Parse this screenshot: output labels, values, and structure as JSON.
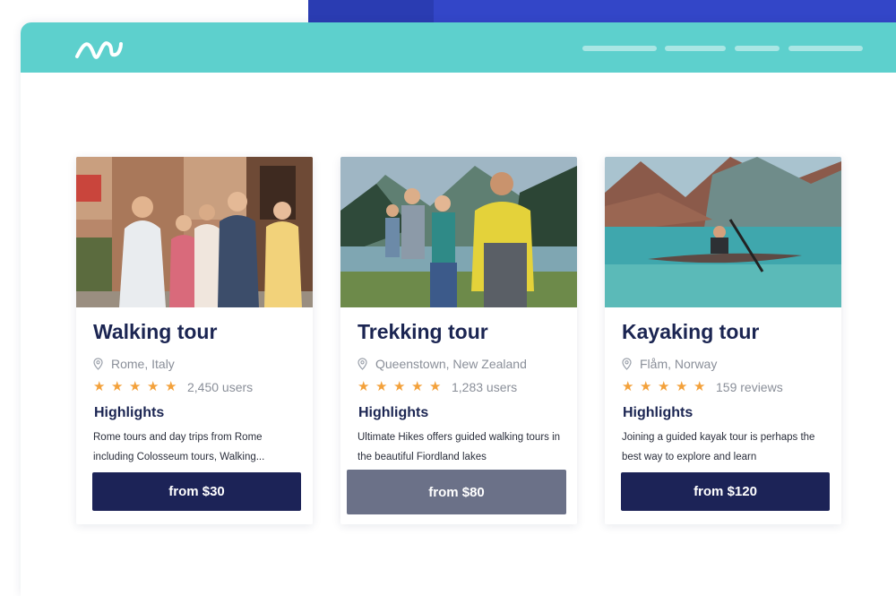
{
  "colors": {
    "topbar": "#5dd0cd",
    "accent_blue": "#3346c8",
    "title_navy": "#1b2552",
    "button_navy": "#1c2357",
    "button_hover": "#6b7188",
    "star": "#f3a13b",
    "muted_text": "#8a8f99"
  },
  "header": {
    "logo_icon": "wave-logo-icon",
    "nav_items": 4
  },
  "tours": [
    {
      "title": "Walking tour",
      "location": "Rome, Italy",
      "rating_stars": 5,
      "count": "2,450 users",
      "highlights_heading": "Highlights",
      "description": "Rome tours and day trips from Rome including Colosseum tours, Walking...",
      "price_button": "from $30"
    },
    {
      "title": "Trekking tour",
      "location": "Queenstown, New Zealand",
      "rating_stars": 5,
      "count": "1,283 users",
      "highlights_heading": "Highlights",
      "description": "Ultimate Hikes offers guided walking tours in the beautiful Fiordland lakes",
      "price_button": "from $80"
    },
    {
      "title": "Kayaking tour",
      "location": "Flåm, Norway",
      "rating_stars": 5,
      "count": "159 reviews",
      "highlights_heading": "Highlights",
      "description": "Joining a guided kayak tour is perhaps the best way to explore and learn",
      "price_button": "from $120"
    }
  ]
}
